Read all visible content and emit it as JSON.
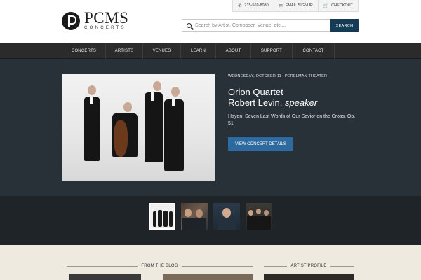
{
  "brand": {
    "name": "PCMS",
    "subtitle": "CONCERTS"
  },
  "utility": {
    "phone": "215-569-8080",
    "email_signup": "EMAIL SIGNUP",
    "checkout": "CHECKOUT"
  },
  "search": {
    "placeholder": "Search by Artist, Composer, Venue, etc....",
    "button": "SEARCH"
  },
  "nav": {
    "items": [
      "CONCERTS",
      "ARTISTS",
      "VENUES",
      "LEARN",
      "ABOUT",
      "SUPPORT",
      "CONTACT"
    ]
  },
  "hero": {
    "date_venue": "WEDNESDAY, OCTOBER 11 | PERELMAN THEATER",
    "title_line1": "Orion Quartet",
    "title_line2_name": "Robert Levin,",
    "title_line2_role": "speaker",
    "program": "Haydn: Seven Last Words of Our Savior on the Cross, Op. 51",
    "cta": "VIEW CONCERT DETAILS"
  },
  "sections": {
    "blog": "FROM THE BLOG",
    "artist": "ARTIST PROFILE"
  },
  "colors": {
    "accent_button": "#2c6aa0",
    "search_button": "#163b56",
    "hero_bg": "#283038",
    "nav_bg": "#2b2b2b",
    "lower_bg": "#eeeadf"
  }
}
